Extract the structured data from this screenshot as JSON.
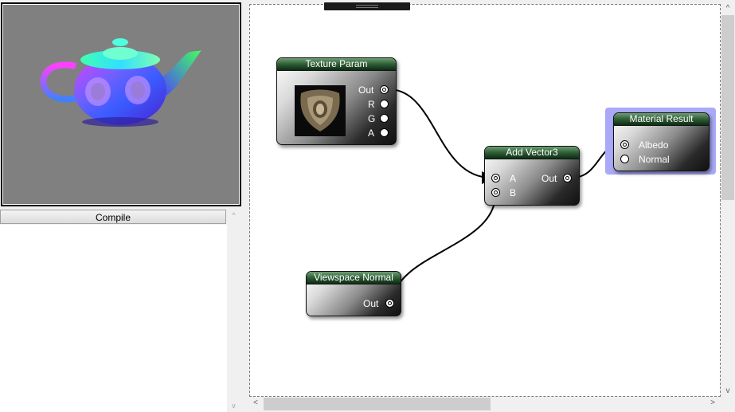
{
  "left_panel": {
    "compile_label": "Compile",
    "scroll_up": "^",
    "scroll_down": "v"
  },
  "graph": {
    "nodes": {
      "texture_param": {
        "title": "Texture Param",
        "ports": {
          "out": "Out",
          "r": "R",
          "g": "G",
          "a": "A"
        }
      },
      "add_vector3": {
        "title": "Add Vector3",
        "ports": {
          "a": "A",
          "b": "B",
          "out": "Out"
        }
      },
      "material_result": {
        "title": "Material Result",
        "selected": true,
        "ports": {
          "albedo": "Albedo",
          "normal": "Normal"
        }
      },
      "viewspace_normal": {
        "title": "Viewspace Normal",
        "ports": {
          "out": "Out"
        }
      }
    },
    "connections": [
      {
        "from": "Texture Param.Out",
        "to": "Add Vector3.A"
      },
      {
        "from": "Viewspace Normal.Out",
        "to": "Add Vector3.B"
      },
      {
        "from": "Add Vector3.Out",
        "to": "Material Result.Albedo"
      }
    ]
  },
  "scrollbars": {
    "left_arrow": "<",
    "right_arrow": ">",
    "up_arrow": "^",
    "down_arrow": "v"
  },
  "colors": {
    "node_title_green": "#2f5e36",
    "selection_highlight": "#a9a9f7",
    "viewport_bg": "#808080"
  }
}
